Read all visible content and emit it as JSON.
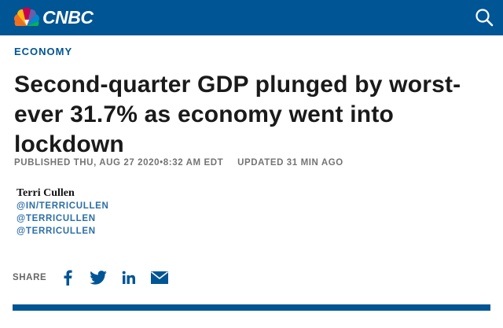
{
  "header": {
    "logo_text": "CNBC",
    "brand_color": "#005594",
    "logo_icon": "nbc-peacock-icon",
    "search_icon": "search-icon"
  },
  "article": {
    "section": "ECONOMY",
    "headline": "Second-quarter GDP plunged by worst-ever 31.7% as economy went into lockdown",
    "published": "PUBLISHED THU, AUG 27 2020•8:32 AM EDT",
    "updated": "UPDATED 31 MIN AGO",
    "author": {
      "name": "Terri Cullen",
      "links": [
        "@IN/TERRICULLEN",
        "@TERRICULLEN",
        "@TERRICULLEN"
      ]
    }
  },
  "share": {
    "label": "SHARE",
    "icons": [
      "facebook-icon",
      "twitter-icon",
      "linkedin-icon",
      "email-icon"
    ],
    "icon_color": "#005594"
  }
}
